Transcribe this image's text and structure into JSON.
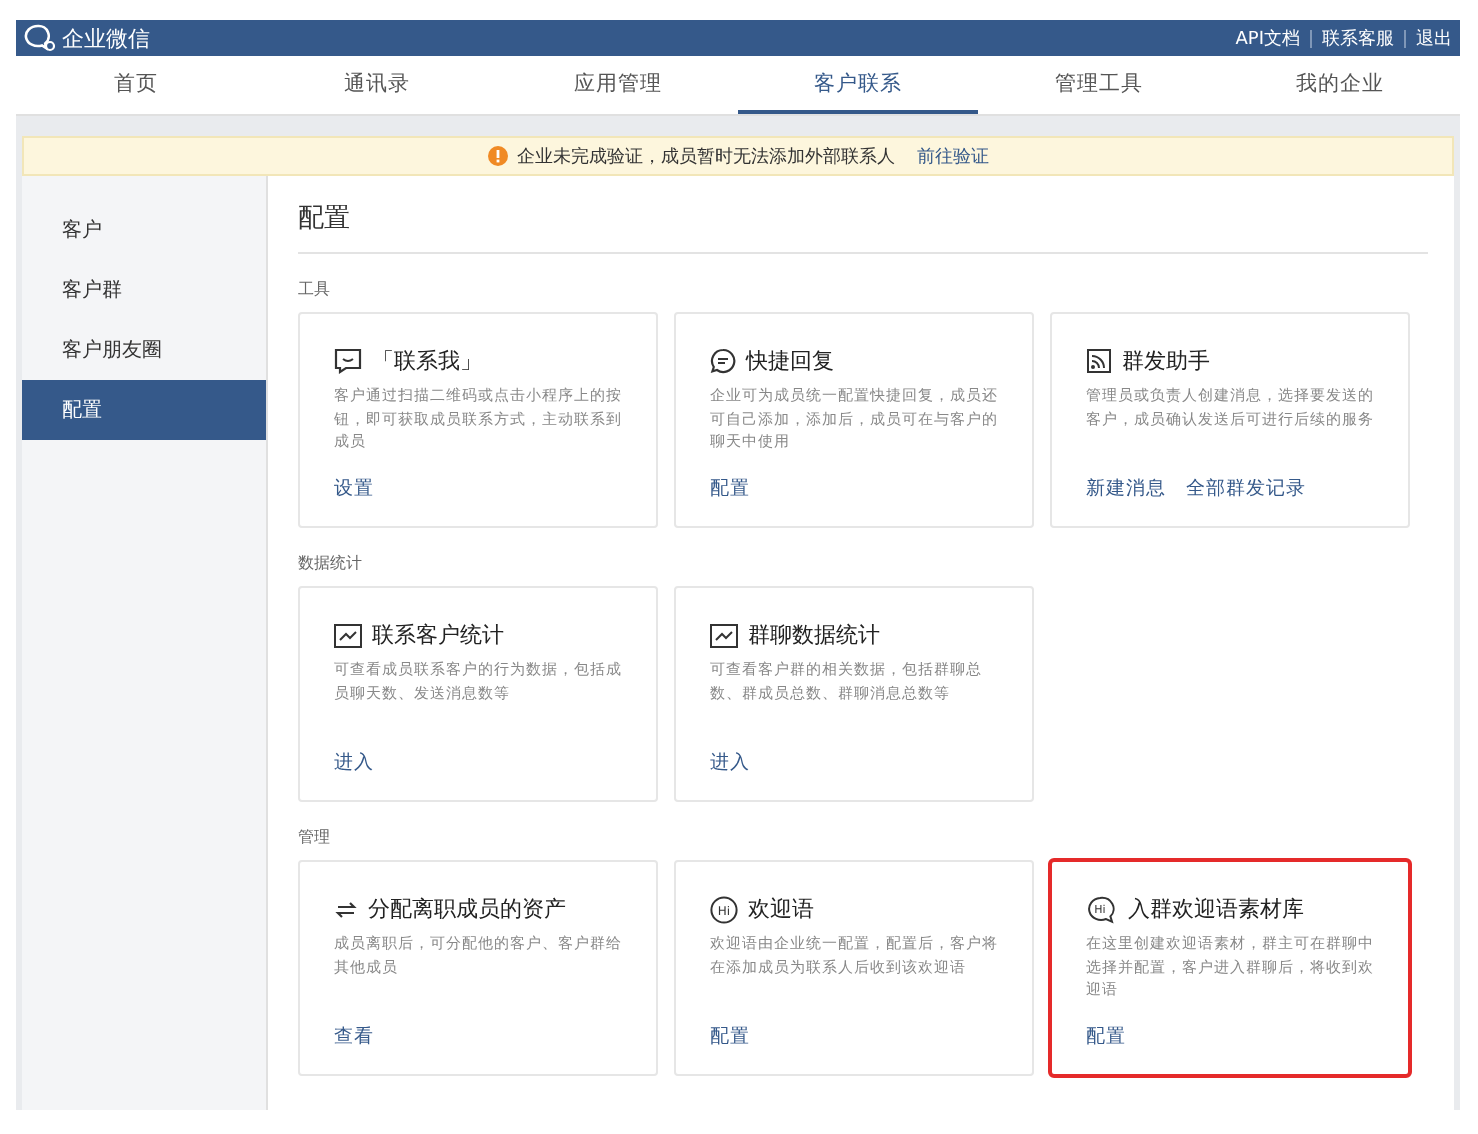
{
  "top_bar": {
    "logo": "企业微信",
    "links": [
      "API文档",
      "联系客服",
      "退出"
    ]
  },
  "nav": [
    {
      "label": "首页",
      "selected": false
    },
    {
      "label": "通讯录",
      "selected": false
    },
    {
      "label": "应用管理",
      "selected": false
    },
    {
      "label": "客户联系",
      "selected": true
    },
    {
      "label": "管理工具",
      "selected": false
    },
    {
      "label": "我的企业",
      "selected": false
    }
  ],
  "notice": {
    "text": "企业未完成验证，成员暂时无法添加外部联系人",
    "link": "前往验证"
  },
  "sidebar": [
    {
      "label": "客户",
      "selected": false
    },
    {
      "label": "客户群",
      "selected": false
    },
    {
      "label": "客户朋友圈",
      "selected": false
    },
    {
      "label": "配置",
      "selected": true
    }
  ],
  "page_title": "配置",
  "sections": [
    {
      "title": "工具",
      "cards": [
        {
          "title": "「联系我」",
          "description": "客户通过扫描二维码或点击小程序上的按钮，即可获取成员联系方式，主动联系到成员",
          "links": [
            "设置"
          ],
          "highlighted": false
        },
        {
          "title": "快捷回复",
          "description": "企业可为成员统一配置快捷回复，成员还可自己添加，添加后，成员可在与客户的聊天中使用",
          "links": [
            "配置"
          ],
          "highlighted": false
        },
        {
          "title": "群发助手",
          "description": "管理员或负责人创建消息，选择要发送的客户，成员确认发送后可进行后续的服务",
          "links": [
            "新建消息",
            "全部群发记录"
          ],
          "highlighted": false
        }
      ]
    },
    {
      "title": "数据统计",
      "cards": [
        {
          "title": "联系客户统计",
          "description": "可查看成员联系客户的行为数据，包括成员聊天数、发送消息数等",
          "links": [
            "进入"
          ],
          "highlighted": false
        },
        {
          "title": "群聊数据统计",
          "description": "可查看客户群的相关数据，包括群聊总数、群成员总数、群聊消息总数等",
          "links": [
            "进入"
          ],
          "highlighted": false
        }
      ]
    },
    {
      "title": "管理",
      "cards": [
        {
          "title": "分配离职成员的资产",
          "description": "成员离职后，可分配他的客户、客户群给其他成员",
          "links": [
            "查看"
          ],
          "highlighted": false
        },
        {
          "title": "欢迎语",
          "icon_text": "Hi",
          "description": "欢迎语由企业统一配置，配置后，客户将在添加成员为联系人后收到该欢迎语",
          "links": [
            "配置"
          ],
          "highlighted": false
        },
        {
          "title": "入群欢迎语素材库",
          "icon_text": "Hi",
          "description": "在这里创建欢迎语素材，群主可在群聊中选择并配置，客户进入群聊后，将收到欢迎语",
          "links": [
            "配置"
          ],
          "highlighted": true
        }
      ]
    }
  ]
}
